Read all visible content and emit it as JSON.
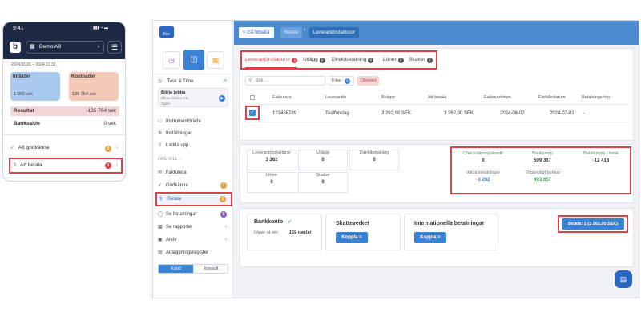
{
  "phone": {
    "time": "9:41",
    "status_icons": "▮▮▮ ⌁ ▬",
    "logo": "b",
    "company": "Demo AB",
    "period": "2024.01.01 – 2024.12.31",
    "income_label": "Intäkter",
    "income_value": "1 000 sek",
    "costs_label": "Kostnader",
    "costs_value": "136 764 sek",
    "result_label": "Resultat",
    "result_value": "-135 764 sek",
    "balance_label": "Banksaldo",
    "balance_value": "0 sek",
    "approve_label": "Att godkänna",
    "approve_count": "2",
    "pay_label": "Att betala",
    "pay_count": "1"
  },
  "sidebar": {
    "logo_text": "flow",
    "task_time": "Task & Time",
    "task_card_title": "Börja jobba",
    "task_card_sub": "Bflow Advisor AB",
    "task_card_status": "Open",
    "items": [
      {
        "label": "Instrumentbräda",
        "icon": "dashboard-icon"
      },
      {
        "label": "Inställningar",
        "icon": "gear-icon"
      },
      {
        "label": "Ladda upp",
        "icon": "upload-icon"
      }
    ],
    "section": "JAG VILL...",
    "actions": [
      {
        "label": "Fakturera",
        "icon": "mail-icon",
        "badge": ""
      },
      {
        "label": "Godkänna",
        "icon": "check-icon",
        "badge": "2"
      },
      {
        "label": "Betala",
        "icon": "dollar-icon",
        "badge": "1"
      },
      {
        "label": "Se betalningar",
        "icon": "payments-icon",
        "badge": "0"
      },
      {
        "label": "Se rapporter",
        "icon": "chart-icon",
        "badge": ""
      },
      {
        "label": "Arkiv",
        "icon": "archive-icon",
        "badge": ""
      },
      {
        "label": "Anläggningsregister",
        "icon": "register-icon",
        "badge": ""
      }
    ],
    "toggle_customer": "Kund",
    "toggle_consultant": "Konsult"
  },
  "topbar": {
    "back_label": "< Gå tillbaka",
    "crumb_1": "Betala",
    "crumb_2": "Leverantörsfakturor"
  },
  "tabs": [
    {
      "label": "Leverantörsfakturor",
      "count": "1"
    },
    {
      "label": "Utlägg",
      "count": "0"
    },
    {
      "label": "Direktbetalning",
      "count": "0"
    },
    {
      "label": "Löner",
      "count": "0"
    },
    {
      "label": "Skatter",
      "count": "0"
    }
  ],
  "search": {
    "placeholder": "Sök...",
    "filter_label": "Filter",
    "filter_count": "1",
    "chip": "Obetald"
  },
  "table": {
    "headers": [
      "Fakturanr.",
      "Leverantör",
      "Belopp",
      "Att betala",
      "Fakturadatum",
      "Förfallodatum",
      "Betalningsdag"
    ],
    "rows": [
      [
        "123456789",
        "Testforetag",
        "3 262,00 SEK",
        "3 262,00 SEK",
        "2024-06-07",
        "2024-07-01",
        "-"
      ]
    ]
  },
  "counts": [
    {
      "label": "Leverantörsfakturor",
      "value": "3 262"
    },
    {
      "label": "Utlägg",
      "value": "0"
    },
    {
      "label": "Direktbetalning",
      "value": "0"
    },
    {
      "label": "Löner",
      "value": "0"
    },
    {
      "label": "Skatter",
      "value": "0"
    }
  ],
  "summary": [
    {
      "label": "Checkräkningskredit",
      "value": "0"
    },
    {
      "label": "Banksaldo",
      "value": "509 337"
    },
    {
      "label": "Betalningar i bank",
      "value": "-12 418"
    },
    {
      "label": "Valda betalningar",
      "value": "-3 262"
    },
    {
      "label": "Tillgängligt belopp",
      "value": "493 657"
    }
  ],
  "bank": {
    "title": "Bankkonto",
    "runs_out": "Löper ut om:",
    "days": "159 dag(ar)"
  },
  "tax": {
    "title": "Skatteverket",
    "button": "Koppla >"
  },
  "intl": {
    "title": "Internationella betalningar",
    "button": "Koppla >"
  },
  "pay_button": "Betala: 1 (3 262,00 SEK)",
  "colors": {
    "accent": "#3a82d6",
    "highlight": "#d9434a",
    "navy": "#1e2a44"
  }
}
